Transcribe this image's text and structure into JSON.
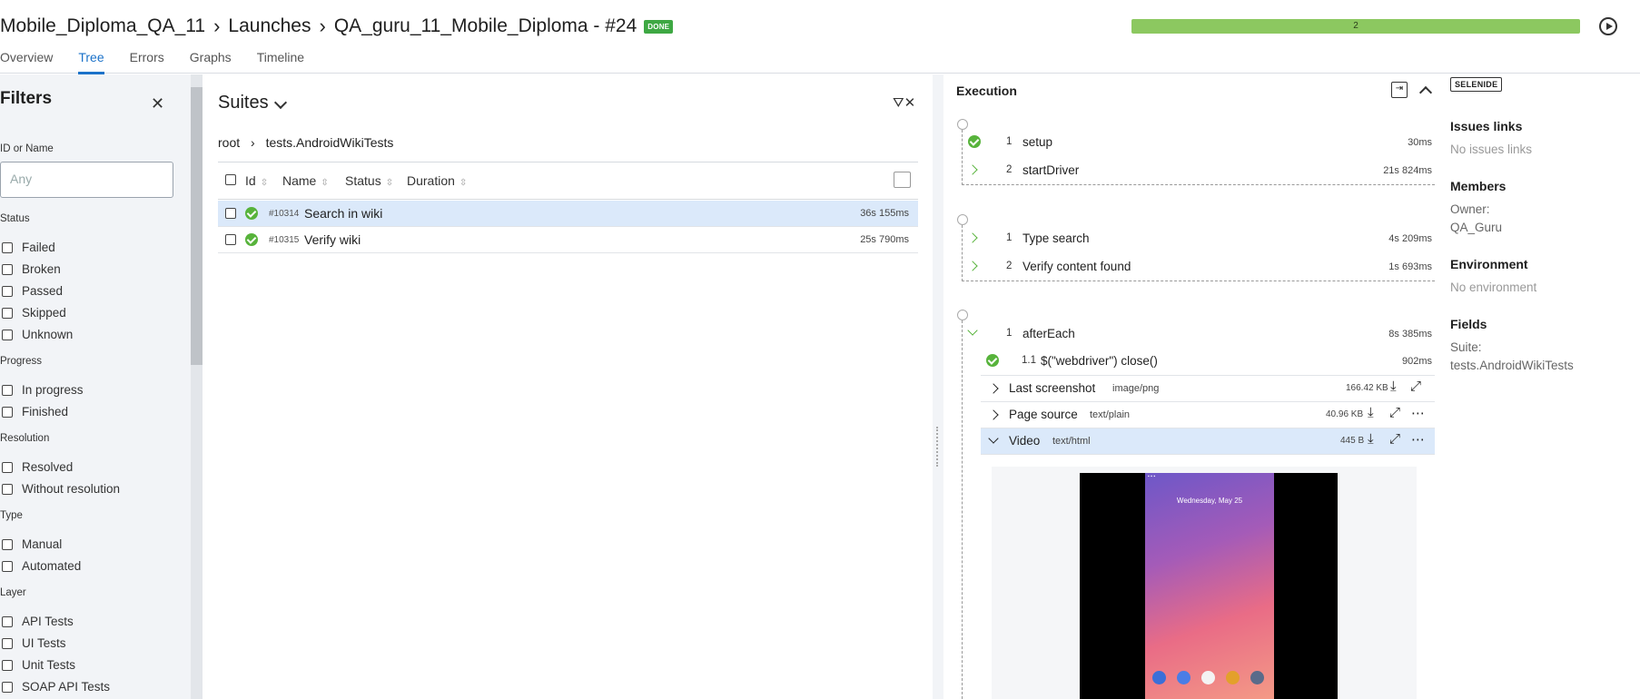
{
  "header": {
    "breadcrumb": [
      "Mobile_Diploma_QA_11",
      "Launches",
      "QA_guru_11_Mobile_Diploma - #24"
    ],
    "status_badge": "DONE",
    "progress_count": "2",
    "progress_fraction": 1.0,
    "tabs": [
      "Overview",
      "Tree",
      "Errors",
      "Graphs",
      "Timeline"
    ],
    "active_tab": "Tree"
  },
  "filters": {
    "title": "Filters",
    "id_label": "ID or Name",
    "id_placeholder": "Any",
    "status_label": "Status",
    "status_items": [
      "Failed",
      "Broken",
      "Passed",
      "Skipped",
      "Unknown"
    ],
    "progress_label": "Progress",
    "progress_items": [
      "In progress",
      "Finished"
    ],
    "resolution_label": "Resolution",
    "resolution_items": [
      "Resolved",
      "Without resolution"
    ],
    "type_label": "Type",
    "type_items": [
      "Manual",
      "Automated"
    ],
    "layer_label": "Layer",
    "layer_items": [
      "API Tests",
      "UI Tests",
      "Unit Tests",
      "SOAP API Tests"
    ]
  },
  "suites": {
    "title": "Suites",
    "crumbs": [
      "root",
      "tests.AndroidWikiTests"
    ],
    "columns": [
      "Id",
      "Name",
      "Status",
      "Duration"
    ],
    "rows": [
      {
        "id": "#10314",
        "name": "Search in wiki",
        "duration": "36s 155ms",
        "status": "passed",
        "selected": true
      },
      {
        "id": "#10315",
        "name": "Verify wiki",
        "duration": "25s 790ms",
        "status": "passed",
        "selected": false
      }
    ]
  },
  "execution": {
    "title": "Execution",
    "setup": [
      {
        "num": "1",
        "name": "setup",
        "dur": "30ms"
      },
      {
        "num": "2",
        "name": "startDriver",
        "dur": "21s 824ms"
      }
    ],
    "body": [
      {
        "num": "1",
        "name": "Type search",
        "dur": "4s 209ms"
      },
      {
        "num": "2",
        "name": "Verify content found",
        "dur": "1s 693ms"
      }
    ],
    "teardown": [
      {
        "num": "1",
        "name": "afterEach",
        "dur": "8s 385ms"
      },
      {
        "num": "1.1",
        "name": "$(\"webdriver\") close()",
        "dur": "902ms"
      }
    ],
    "attachments": [
      {
        "name": "Last screenshot",
        "type": "image/png",
        "size": "166.42 KB"
      },
      {
        "name": "Page source",
        "type": "text/plain",
        "size": "40.96 KB"
      },
      {
        "name": "Video",
        "type": "text/html",
        "size": "445 B"
      }
    ],
    "video_date": "Wednesday, May 25"
  },
  "side": {
    "tag": "SELENIDE",
    "issues_title": "Issues links",
    "issues_value": "No issues links",
    "members_title": "Members",
    "owner_label": "Owner:",
    "owner_value": "QA_Guru",
    "env_title": "Environment",
    "env_value": "No environment",
    "fields_title": "Fields",
    "suite_label": "Suite:",
    "suite_value": "tests.AndroidWikiTests"
  }
}
